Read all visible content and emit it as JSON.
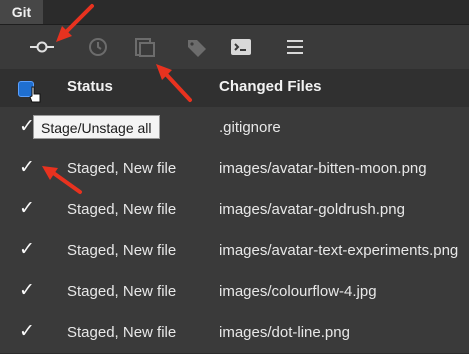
{
  "window": {
    "tab_label": "Git"
  },
  "toolbar": {
    "buttons": [
      {
        "name": "commit-icon"
      },
      {
        "name": "history-icon"
      },
      {
        "name": "stash-icon"
      },
      {
        "name": "tag-icon"
      },
      {
        "name": "terminal-icon"
      },
      {
        "name": "menu-icon"
      }
    ]
  },
  "table": {
    "headers": {
      "status": "Status",
      "files": "Changed Files"
    },
    "select_all_tooltip": "Stage/Unstage all",
    "rows": [
      {
        "checked": true,
        "status": "",
        "file": ".gitignore"
      },
      {
        "checked": true,
        "status": "Staged, New file",
        "file": "images/avatar-bitten-moon.png"
      },
      {
        "checked": true,
        "status": "Staged, New file",
        "file": "images/avatar-goldrush.png"
      },
      {
        "checked": true,
        "status": "Staged, New file",
        "file": "images/avatar-text-experiments.png"
      },
      {
        "checked": true,
        "status": "Staged, New file",
        "file": "images/colourflow-4.jpg"
      },
      {
        "checked": true,
        "status": "Staged, New file",
        "file": "images/dot-line.png"
      }
    ]
  },
  "colors": {
    "accent": "#1f6fd0",
    "annotation_arrow": "#e8321f",
    "background": "#3a3a3a"
  }
}
